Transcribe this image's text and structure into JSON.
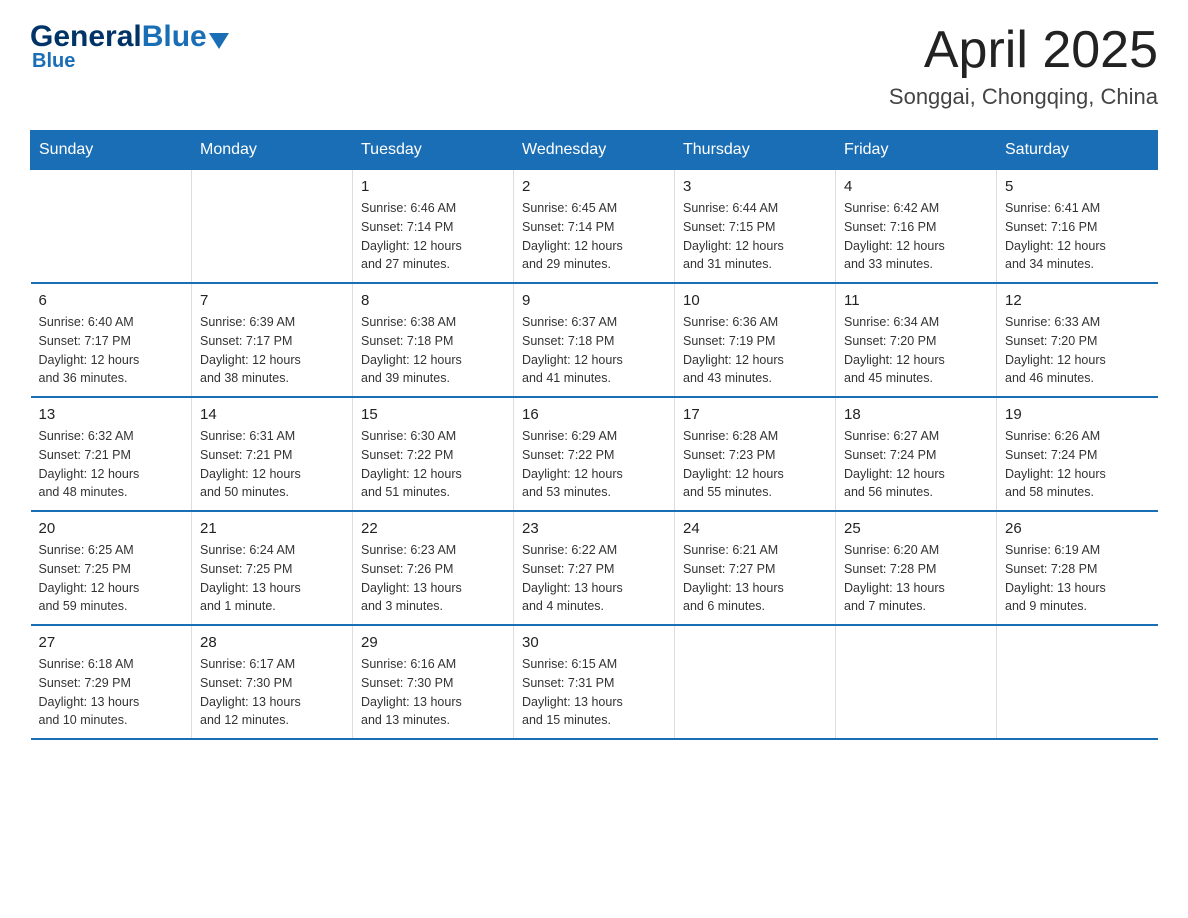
{
  "header": {
    "logo_general": "General",
    "logo_blue": "Blue",
    "title": "April 2025",
    "subtitle": "Songgai, Chongqing, China"
  },
  "weekdays": [
    "Sunday",
    "Monday",
    "Tuesday",
    "Wednesday",
    "Thursday",
    "Friday",
    "Saturday"
  ],
  "weeks": [
    [
      {
        "day": "",
        "info": ""
      },
      {
        "day": "",
        "info": ""
      },
      {
        "day": "1",
        "info": "Sunrise: 6:46 AM\nSunset: 7:14 PM\nDaylight: 12 hours\nand 27 minutes."
      },
      {
        "day": "2",
        "info": "Sunrise: 6:45 AM\nSunset: 7:14 PM\nDaylight: 12 hours\nand 29 minutes."
      },
      {
        "day": "3",
        "info": "Sunrise: 6:44 AM\nSunset: 7:15 PM\nDaylight: 12 hours\nand 31 minutes."
      },
      {
        "day": "4",
        "info": "Sunrise: 6:42 AM\nSunset: 7:16 PM\nDaylight: 12 hours\nand 33 minutes."
      },
      {
        "day": "5",
        "info": "Sunrise: 6:41 AM\nSunset: 7:16 PM\nDaylight: 12 hours\nand 34 minutes."
      }
    ],
    [
      {
        "day": "6",
        "info": "Sunrise: 6:40 AM\nSunset: 7:17 PM\nDaylight: 12 hours\nand 36 minutes."
      },
      {
        "day": "7",
        "info": "Sunrise: 6:39 AM\nSunset: 7:17 PM\nDaylight: 12 hours\nand 38 minutes."
      },
      {
        "day": "8",
        "info": "Sunrise: 6:38 AM\nSunset: 7:18 PM\nDaylight: 12 hours\nand 39 minutes."
      },
      {
        "day": "9",
        "info": "Sunrise: 6:37 AM\nSunset: 7:18 PM\nDaylight: 12 hours\nand 41 minutes."
      },
      {
        "day": "10",
        "info": "Sunrise: 6:36 AM\nSunset: 7:19 PM\nDaylight: 12 hours\nand 43 minutes."
      },
      {
        "day": "11",
        "info": "Sunrise: 6:34 AM\nSunset: 7:20 PM\nDaylight: 12 hours\nand 45 minutes."
      },
      {
        "day": "12",
        "info": "Sunrise: 6:33 AM\nSunset: 7:20 PM\nDaylight: 12 hours\nand 46 minutes."
      }
    ],
    [
      {
        "day": "13",
        "info": "Sunrise: 6:32 AM\nSunset: 7:21 PM\nDaylight: 12 hours\nand 48 minutes."
      },
      {
        "day": "14",
        "info": "Sunrise: 6:31 AM\nSunset: 7:21 PM\nDaylight: 12 hours\nand 50 minutes."
      },
      {
        "day": "15",
        "info": "Sunrise: 6:30 AM\nSunset: 7:22 PM\nDaylight: 12 hours\nand 51 minutes."
      },
      {
        "day": "16",
        "info": "Sunrise: 6:29 AM\nSunset: 7:22 PM\nDaylight: 12 hours\nand 53 minutes."
      },
      {
        "day": "17",
        "info": "Sunrise: 6:28 AM\nSunset: 7:23 PM\nDaylight: 12 hours\nand 55 minutes."
      },
      {
        "day": "18",
        "info": "Sunrise: 6:27 AM\nSunset: 7:24 PM\nDaylight: 12 hours\nand 56 minutes."
      },
      {
        "day": "19",
        "info": "Sunrise: 6:26 AM\nSunset: 7:24 PM\nDaylight: 12 hours\nand 58 minutes."
      }
    ],
    [
      {
        "day": "20",
        "info": "Sunrise: 6:25 AM\nSunset: 7:25 PM\nDaylight: 12 hours\nand 59 minutes."
      },
      {
        "day": "21",
        "info": "Sunrise: 6:24 AM\nSunset: 7:25 PM\nDaylight: 13 hours\nand 1 minute."
      },
      {
        "day": "22",
        "info": "Sunrise: 6:23 AM\nSunset: 7:26 PM\nDaylight: 13 hours\nand 3 minutes."
      },
      {
        "day": "23",
        "info": "Sunrise: 6:22 AM\nSunset: 7:27 PM\nDaylight: 13 hours\nand 4 minutes."
      },
      {
        "day": "24",
        "info": "Sunrise: 6:21 AM\nSunset: 7:27 PM\nDaylight: 13 hours\nand 6 minutes."
      },
      {
        "day": "25",
        "info": "Sunrise: 6:20 AM\nSunset: 7:28 PM\nDaylight: 13 hours\nand 7 minutes."
      },
      {
        "day": "26",
        "info": "Sunrise: 6:19 AM\nSunset: 7:28 PM\nDaylight: 13 hours\nand 9 minutes."
      }
    ],
    [
      {
        "day": "27",
        "info": "Sunrise: 6:18 AM\nSunset: 7:29 PM\nDaylight: 13 hours\nand 10 minutes."
      },
      {
        "day": "28",
        "info": "Sunrise: 6:17 AM\nSunset: 7:30 PM\nDaylight: 13 hours\nand 12 minutes."
      },
      {
        "day": "29",
        "info": "Sunrise: 6:16 AM\nSunset: 7:30 PM\nDaylight: 13 hours\nand 13 minutes."
      },
      {
        "day": "30",
        "info": "Sunrise: 6:15 AM\nSunset: 7:31 PM\nDaylight: 13 hours\nand 15 minutes."
      },
      {
        "day": "",
        "info": ""
      },
      {
        "day": "",
        "info": ""
      },
      {
        "day": "",
        "info": ""
      }
    ]
  ]
}
